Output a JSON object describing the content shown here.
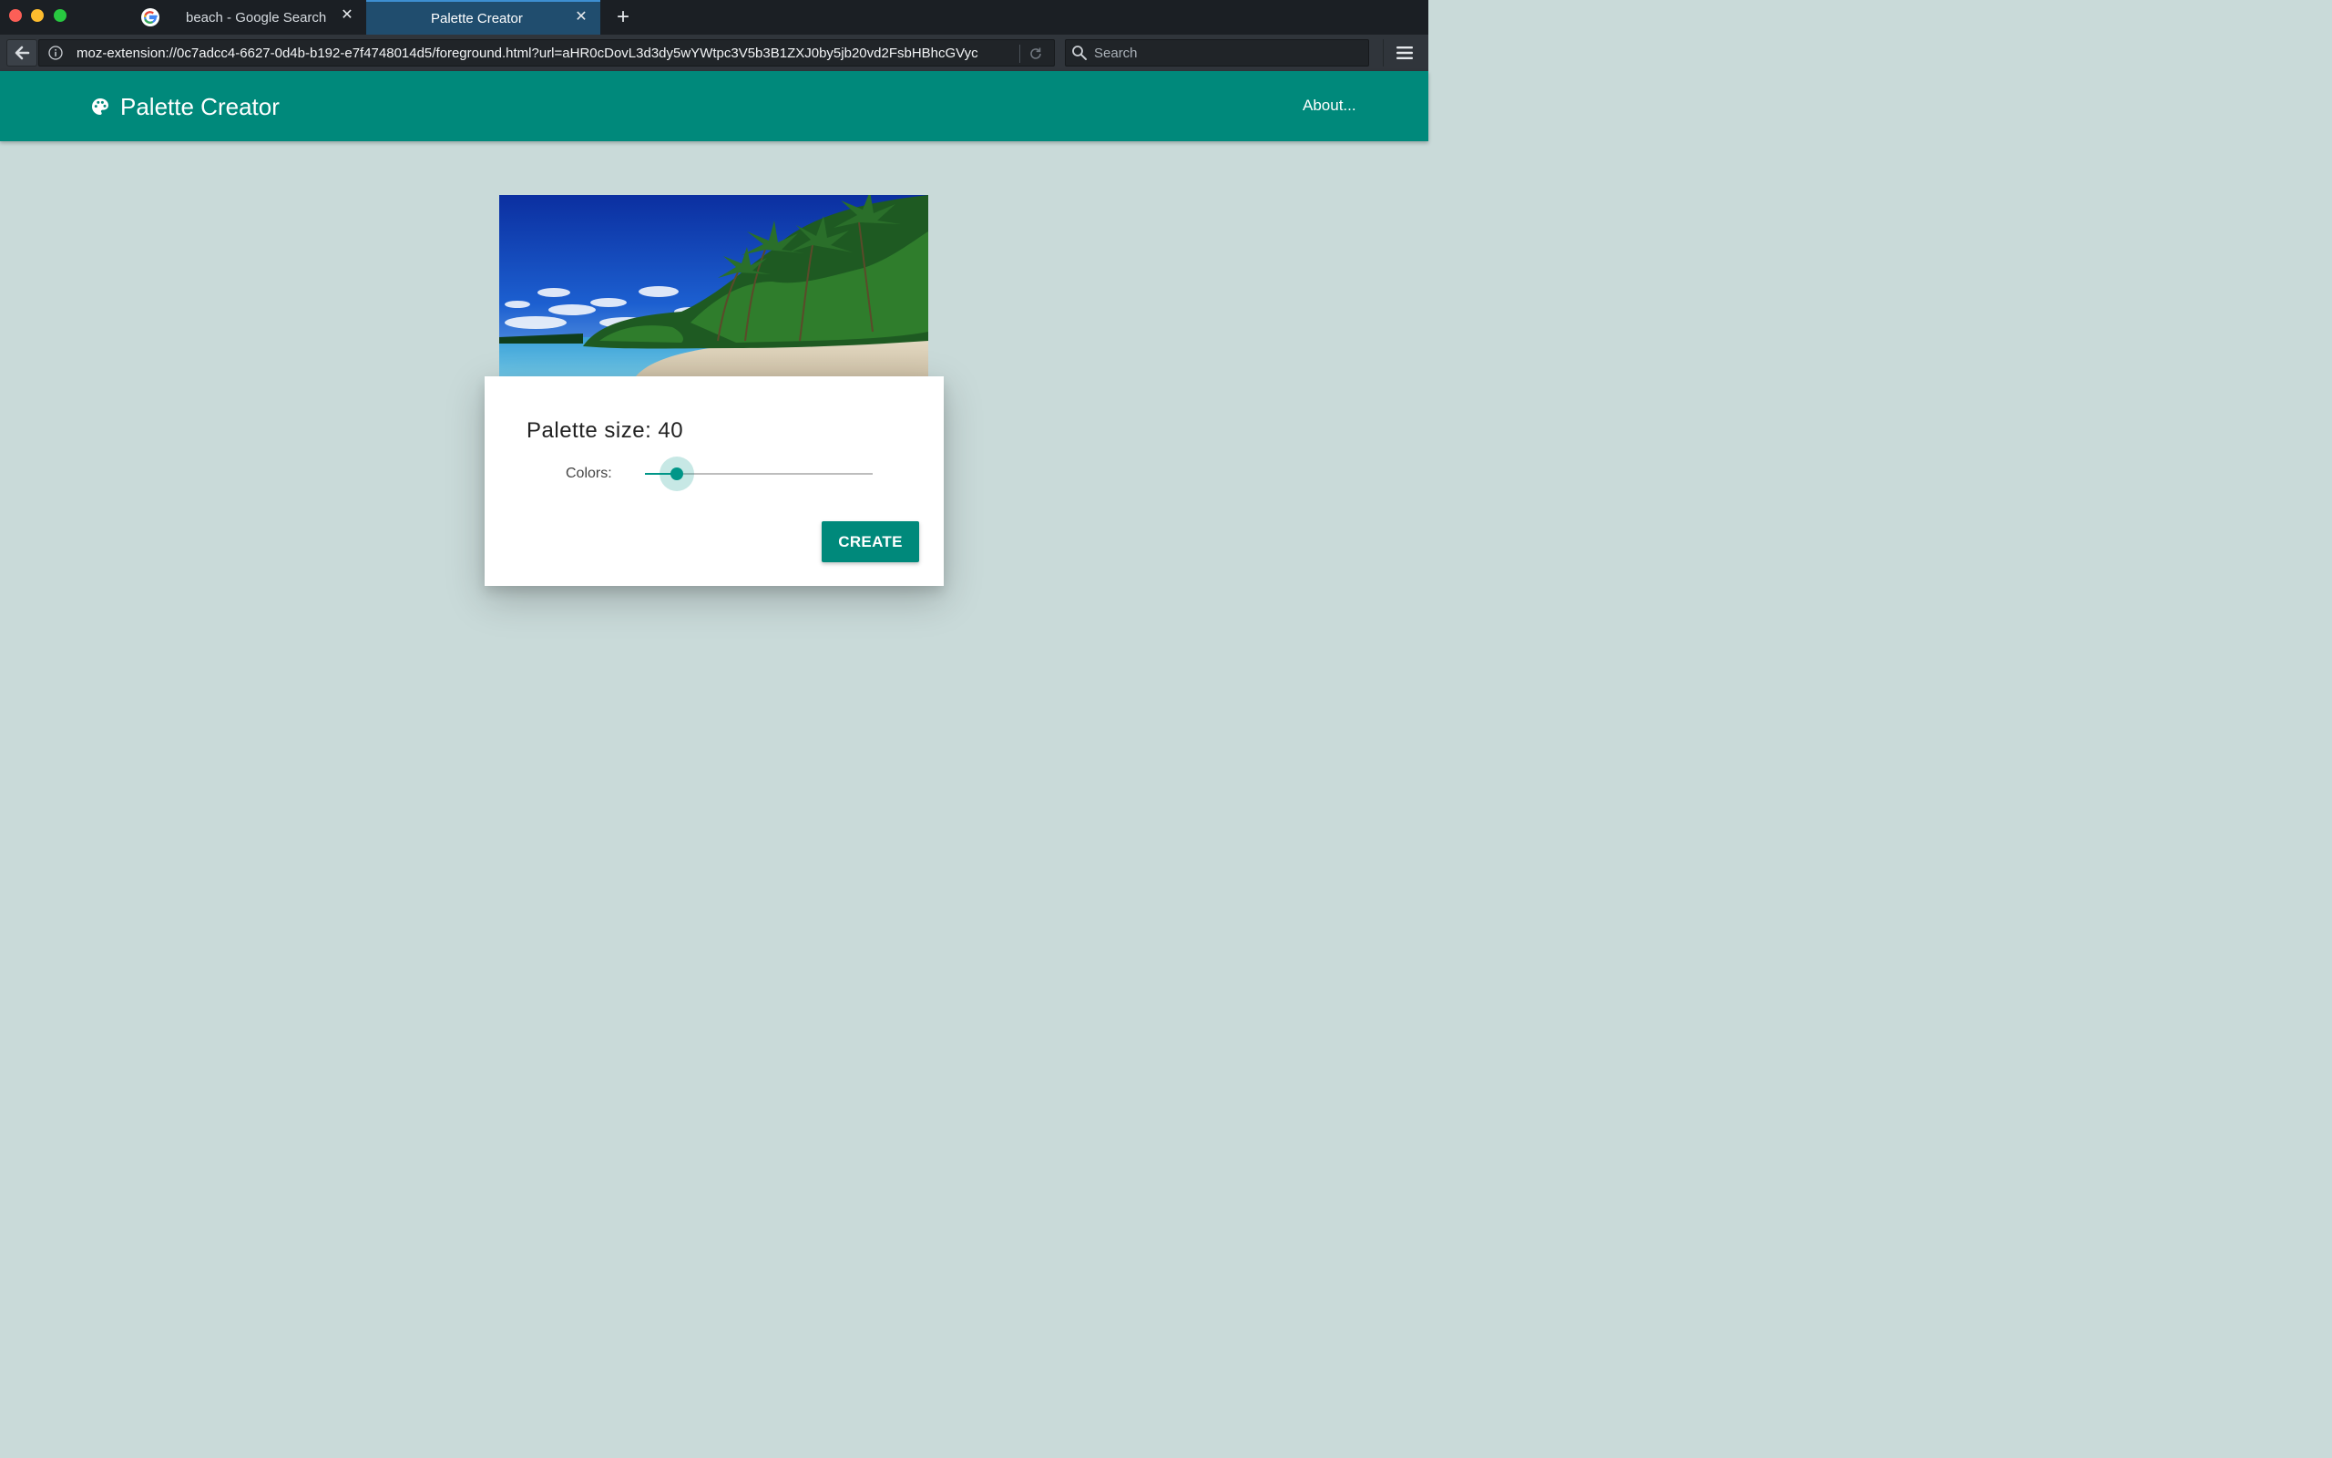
{
  "browser": {
    "tabs": [
      {
        "title": "beach - Google Search",
        "active": false,
        "favicon": "google-g-icon"
      },
      {
        "title": "Palette Creator",
        "active": true
      }
    ],
    "new_tab_label": "+",
    "url": "moz-extension://0c7adcc4-6627-0d4b-b192-e7f4748014d5/foreground.html?url=aHR0cDovL3d3dy5wYWtpc3V5b3B1ZXJ0by5jb20vd2FsbHBhcGVyc",
    "search_placeholder": "Search"
  },
  "app": {
    "title": "Palette Creator",
    "about_label": "About...",
    "brand_color": "#00897b",
    "background_color": "#c9dad9"
  },
  "dialog": {
    "heading": "Palette size: 40",
    "colors_label": "Colors:",
    "slider_fraction": 0.14,
    "create_label": "CREATE"
  }
}
